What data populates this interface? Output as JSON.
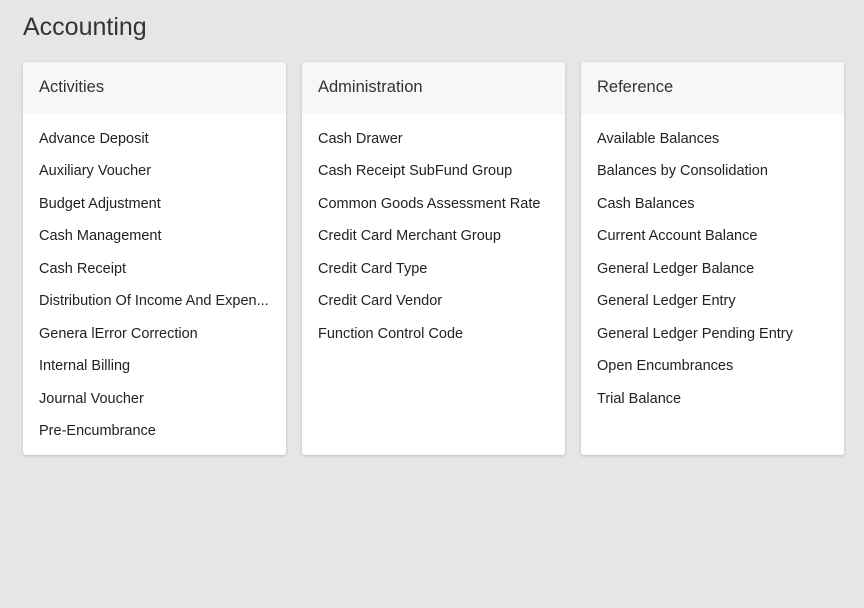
{
  "page": {
    "title": "Accounting"
  },
  "sections": [
    {
      "title": "Activities",
      "items": [
        "Advance Deposit",
        "Auxiliary Voucher",
        "Budget Adjustment",
        "Cash Management",
        "Cash Receipt",
        "Distribution Of Income And Expen...",
        "Genera lError Correction",
        "Internal Billing",
        "Journal Voucher",
        "Pre-Encumbrance"
      ]
    },
    {
      "title": "Administration",
      "items": [
        "Cash Drawer",
        "Cash Receipt SubFund Group",
        "Common Goods Assessment Rate",
        "Credit Card Merchant Group",
        "Credit Card Type",
        "Credit Card Vendor",
        "Function Control Code"
      ]
    },
    {
      "title": "Reference",
      "items": [
        "Available Balances",
        "Balances by Consolidation",
        "Cash Balances",
        "Current Account Balance",
        "General Ledger Balance",
        "General Ledger Entry",
        "General Ledger Pending Entry",
        "Open Encumbrances",
        "Trial Balance"
      ]
    }
  ]
}
